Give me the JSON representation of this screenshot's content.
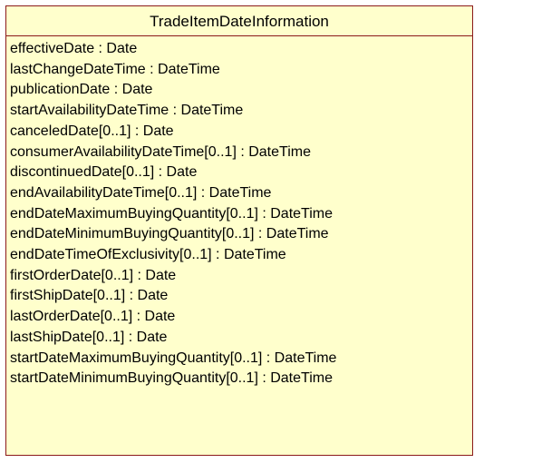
{
  "class": {
    "name": "TradeItemDateInformation",
    "attributes": [
      "effectiveDate : Date",
      "lastChangeDateTime : DateTime",
      "publicationDate : Date",
      "startAvailabilityDateTime : DateTime",
      "canceledDate[0..1] : Date",
      "consumerAvailabilityDateTime[0..1] : DateTime",
      "discontinuedDate[0..1] : Date",
      "endAvailabilityDateTime[0..1] : DateTime",
      "endDateMaximumBuyingQuantity[0..1] : DateTime",
      "endDateMinimumBuyingQuantity[0..1] : DateTime",
      "endDateTimeOfExclusivity[0..1] : DateTime",
      "firstOrderDate[0..1] : Date",
      "firstShipDate[0..1] : Date",
      "lastOrderDate[0..1] : Date",
      "lastShipDate[0..1] : Date",
      "startDateMaximumBuyingQuantity[0..1] : DateTime",
      "startDateMinimumBuyingQuantity[0..1] : DateTime"
    ]
  },
  "colors": {
    "fill": "#ffffcc",
    "border": "#8b1a1a"
  }
}
